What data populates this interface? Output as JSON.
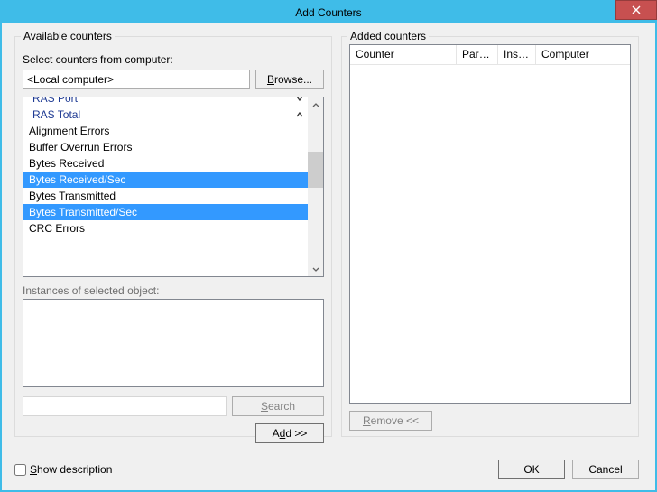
{
  "window": {
    "title": "Add Counters"
  },
  "groups": {
    "available": "Available counters",
    "added": "Added counters"
  },
  "labels": {
    "select_computer": "Select counters from computer:",
    "instances": "Instances of selected object:"
  },
  "computer_combo": {
    "value": "<Local computer>"
  },
  "buttons": {
    "browse": "Browse...",
    "browse_accesskey": "B",
    "search": "Search",
    "search_accesskey": "S",
    "add": "Add >>",
    "add_accesskey": "d",
    "remove": "Remove <<",
    "remove_accesskey": "R",
    "ok": "OK",
    "cancel": "Cancel"
  },
  "show_description": "Show description",
  "show_description_accesskey": "S",
  "counter_tree": {
    "scroll_offset": 1,
    "items": [
      {
        "type": "category",
        "label": "RAS Port",
        "expanded": false
      },
      {
        "type": "category",
        "label": "RAS Total",
        "expanded": true
      },
      {
        "type": "counter",
        "label": "Alignment Errors",
        "selected": false
      },
      {
        "type": "counter",
        "label": "Buffer Overrun Errors",
        "selected": false
      },
      {
        "type": "counter",
        "label": "Bytes Received",
        "selected": false
      },
      {
        "type": "counter",
        "label": "Bytes Received/Sec",
        "selected": true
      },
      {
        "type": "counter",
        "label": "Bytes Transmitted",
        "selected": false
      },
      {
        "type": "counter",
        "label": "Bytes Transmitted/Sec",
        "selected": true
      },
      {
        "type": "counter",
        "label": "CRC Errors",
        "selected": false
      }
    ]
  },
  "added_columns": [
    {
      "label": "Counter",
      "width": 118
    },
    {
      "label": "Parent",
      "width": 46
    },
    {
      "label": "Inst...",
      "width": 42
    },
    {
      "label": "Computer",
      "width": 0
    }
  ]
}
